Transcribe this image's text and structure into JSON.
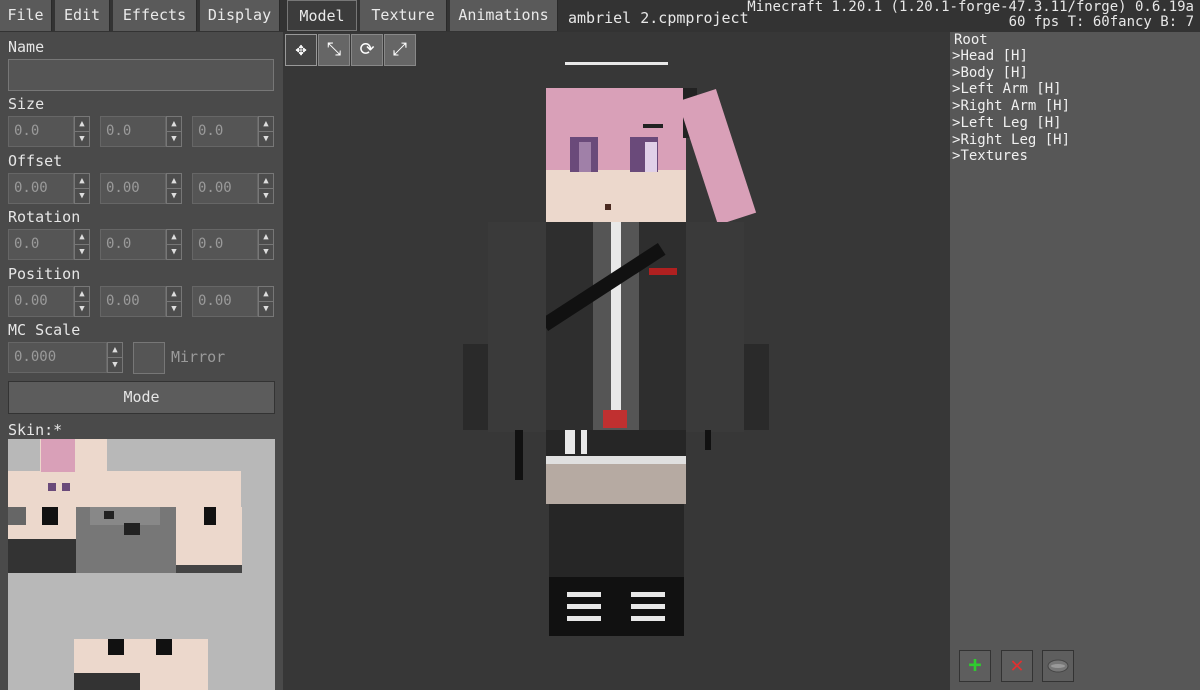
{
  "menu": {
    "file": "File",
    "edit": "Edit",
    "effects": "Effects",
    "display": "Display"
  },
  "tabs": {
    "model": "Model",
    "texture": "Texture",
    "animations": "Animations"
  },
  "project_name": "ambriel 2.cpmproject",
  "version": {
    "line1": "Minecraft 1.20.1 (1.20.1-forge-47.3.11/forge) 0.6.19a",
    "line2": "60 fps T: 60fancy B: 7"
  },
  "props": {
    "name_label": "Name",
    "name_value": "",
    "size_label": "Size",
    "size": [
      "0.0",
      "0.0",
      "0.0"
    ],
    "offset_label": "Offset",
    "offset": [
      "0.00",
      "0.00",
      "0.00"
    ],
    "rotation_label": "Rotation",
    "rotation": [
      "0.0",
      "0.0",
      "0.0"
    ],
    "position_label": "Position",
    "position": [
      "0.00",
      "0.00",
      "0.00"
    ],
    "mcscale_label": "MC Scale",
    "mcscale": "0.000",
    "mirror_label": "Mirror",
    "mode_label": "Mode",
    "skin_label": "Skin:*"
  },
  "tree": {
    "root": "Root",
    "items": [
      "Head [H]",
      "Body [H]",
      "Left Arm [H]",
      "Right Arm [H]",
      "Left Leg [H]",
      "Right Leg [H]",
      "Textures"
    ]
  },
  "icons": {
    "move": "move-icon",
    "scale": "scale-icon",
    "rotate": "rotate-icon",
    "resize": "resize-icon",
    "add": "plus-icon",
    "delete": "x-icon",
    "visibility": "eye-icon"
  },
  "colors": {
    "panel": "#4a4a4a",
    "viewport": "#373737",
    "tree_panel": "#575757",
    "add": "#2ecc2e",
    "delete": "#e03030",
    "hair": "#d9a0b8",
    "skin": "#ecd8cc"
  }
}
